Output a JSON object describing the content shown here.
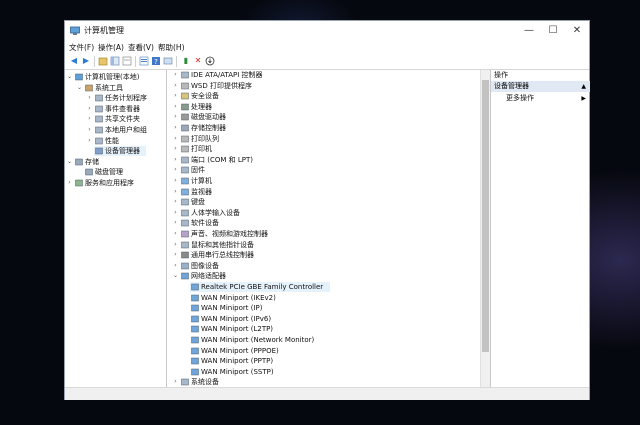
{
  "window": {
    "title": "计算机管理",
    "controls": [
      "—",
      "☐",
      "✕"
    ]
  },
  "menu": [
    "文件(F)",
    "操作(A)",
    "查看(V)",
    "帮助(H)"
  ],
  "toolbar": {
    "icons": [
      "back-icon",
      "forward-icon",
      "up-icon",
      "console-tree-icon",
      "export-icon",
      "properties-icon",
      "help-icon",
      "scan-icon",
      "uninstall-icon",
      "disable-icon"
    ]
  },
  "left_tree": [
    {
      "label": "计算机管理(本地)",
      "icon": "computer-management-icon",
      "level": 0,
      "expander": "v"
    },
    {
      "label": "系统工具",
      "icon": "tools-icon",
      "level": 1,
      "expander": "v"
    },
    {
      "label": "任务计划程序",
      "icon": "task-scheduler-icon",
      "level": 2,
      "expander": ">"
    },
    {
      "label": "事件查看器",
      "icon": "event-viewer-icon",
      "level": 2,
      "expander": ">"
    },
    {
      "label": "共享文件夹",
      "icon": "shared-folder-icon",
      "level": 2,
      "expander": ">"
    },
    {
      "label": "本地用户和组",
      "icon": "users-icon",
      "level": 2,
      "expander": ">"
    },
    {
      "label": "性能",
      "icon": "performance-icon",
      "level": 2,
      "expander": ">"
    },
    {
      "label": "设备管理器",
      "icon": "device-manager-icon",
      "level": 2,
      "expander": "",
      "selected": true
    },
    {
      "label": "存储",
      "icon": "storage-icon",
      "level": 0,
      "expander": "v"
    },
    {
      "label": "磁盘管理",
      "icon": "disk-icon",
      "level": 1,
      "expander": ""
    },
    {
      "label": "服务和应用程序",
      "icon": "services-icon",
      "level": 0,
      "expander": ">"
    }
  ],
  "device_tree": [
    {
      "label": "IDE ATA/ATAPI 控制器",
      "icon": "ide-icon",
      "expander": ">"
    },
    {
      "label": "WSD 打印提供程序",
      "icon": "printer-icon",
      "expander": ">"
    },
    {
      "label": "安全设备",
      "icon": "security-icon",
      "expander": ">"
    },
    {
      "label": "处理器",
      "icon": "processor-icon",
      "expander": ">"
    },
    {
      "label": "磁盘驱动器",
      "icon": "disk-drive-icon",
      "expander": ">"
    },
    {
      "label": "存储控制器",
      "icon": "storage-controller-icon",
      "expander": ">"
    },
    {
      "label": "打印队列",
      "icon": "print-queue-icon",
      "expander": ">"
    },
    {
      "label": "打印机",
      "icon": "printer-icon",
      "expander": ">"
    },
    {
      "label": "端口 (COM 和 LPT)",
      "icon": "port-icon",
      "expander": ">"
    },
    {
      "label": "固件",
      "icon": "firmware-icon",
      "expander": ">"
    },
    {
      "label": "计算机",
      "icon": "computer-icon",
      "expander": ">"
    },
    {
      "label": "监视器",
      "icon": "monitor-icon",
      "expander": ">"
    },
    {
      "label": "键盘",
      "icon": "keyboard-icon",
      "expander": ">"
    },
    {
      "label": "人体学输入设备",
      "icon": "hid-icon",
      "expander": ">"
    },
    {
      "label": "软件设备",
      "icon": "software-device-icon",
      "expander": ">"
    },
    {
      "label": "声音、视频和游戏控制器",
      "icon": "sound-icon",
      "expander": ">"
    },
    {
      "label": "鼠标和其他指针设备",
      "icon": "mouse-icon",
      "expander": ">"
    },
    {
      "label": "通用串行总线控制器",
      "icon": "usb-icon",
      "expander": ">"
    },
    {
      "label": "图像设备",
      "icon": "camera-icon",
      "expander": ">"
    },
    {
      "label": "网络适配器",
      "icon": "network-adapter-icon",
      "expander": "v"
    },
    {
      "label": "Realtek PCIe GBE Family Controller",
      "icon": "network-card-icon",
      "expander": "",
      "child": true,
      "highlight": true
    },
    {
      "label": "WAN Miniport (IKEv2)",
      "icon": "network-card-icon",
      "expander": "",
      "child": true
    },
    {
      "label": "WAN Miniport (IP)",
      "icon": "network-card-icon",
      "expander": "",
      "child": true
    },
    {
      "label": "WAN Miniport (IPv6)",
      "icon": "network-card-icon",
      "expander": "",
      "child": true
    },
    {
      "label": "WAN Miniport (L2TP)",
      "icon": "network-card-icon",
      "expander": "",
      "child": true
    },
    {
      "label": "WAN Miniport (Network Monitor)",
      "icon": "network-card-icon",
      "expander": "",
      "child": true
    },
    {
      "label": "WAN Miniport (PPPOE)",
      "icon": "network-card-icon",
      "expander": "",
      "child": true
    },
    {
      "label": "WAN Miniport (PPTP)",
      "icon": "network-card-icon",
      "expander": "",
      "child": true
    },
    {
      "label": "WAN Miniport (SSTP)",
      "icon": "network-card-icon",
      "expander": "",
      "child": true
    },
    {
      "label": "系统设备",
      "icon": "system-device-icon",
      "expander": ">"
    }
  ],
  "actions": {
    "header": "操作",
    "section": "设备管理器",
    "more": "更多操作"
  },
  "colors": {
    "selection": "#cce4f7",
    "hover": "#e5f1fb",
    "background": "#06080f"
  }
}
